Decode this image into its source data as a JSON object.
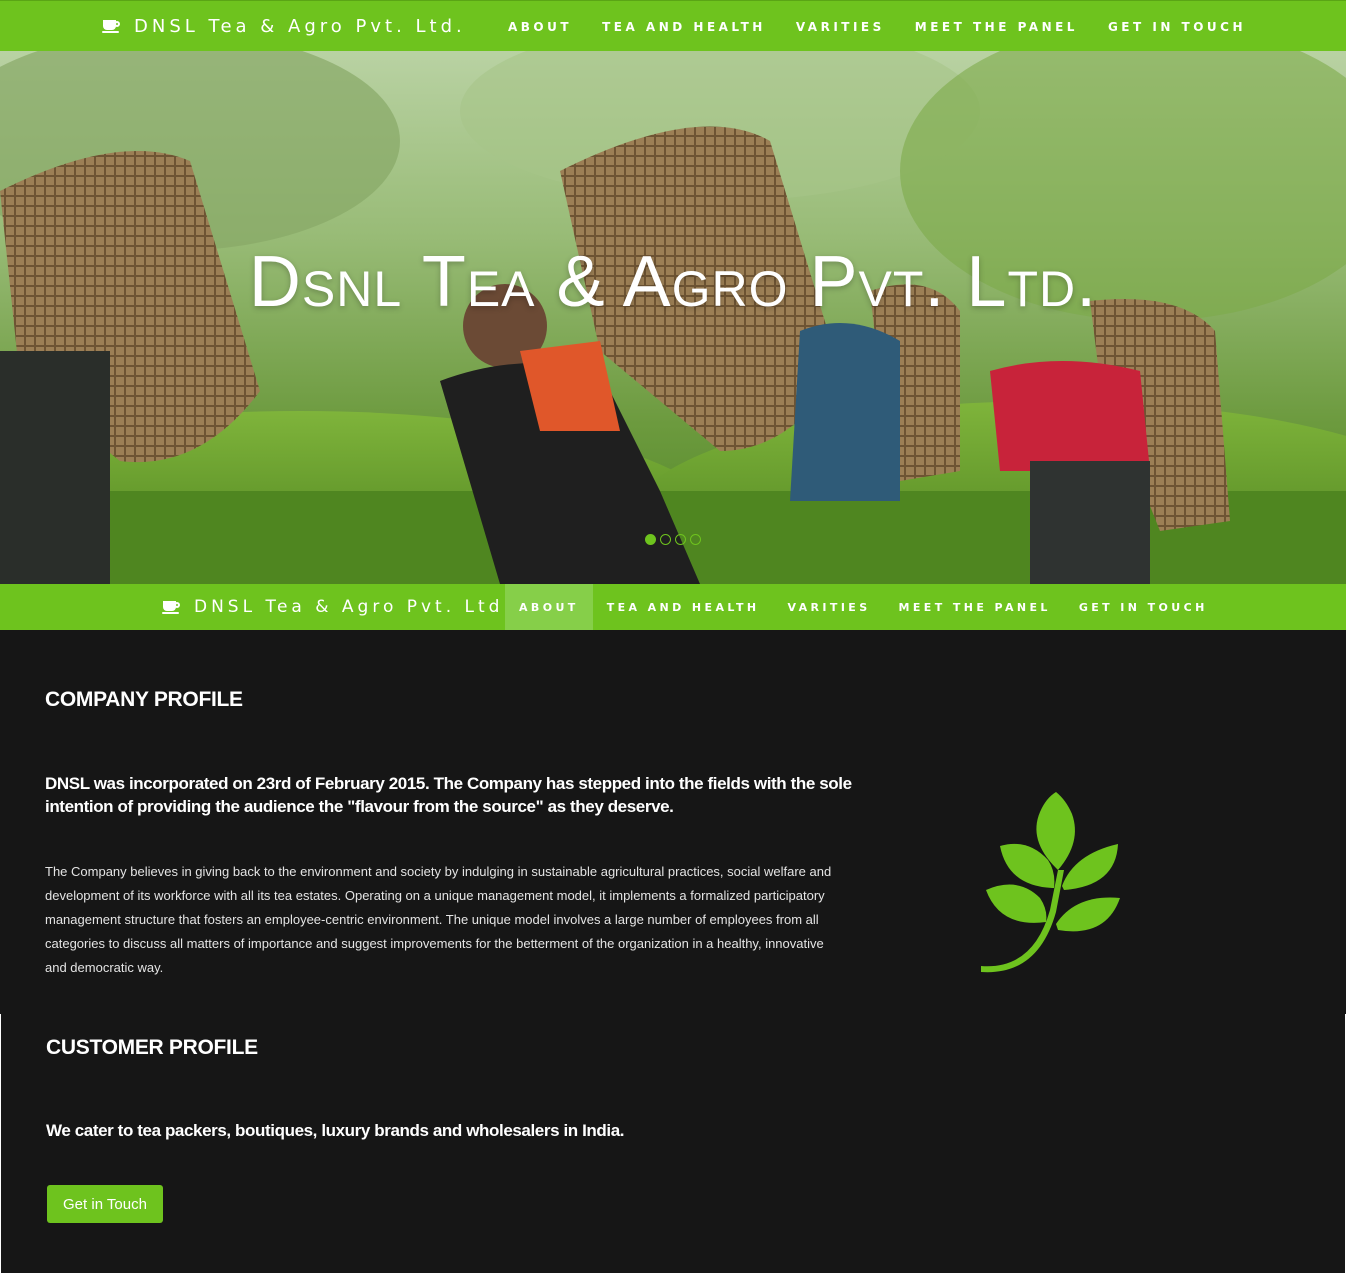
{
  "brand": {
    "name": "DNSL Tea & Agro Pvt. Ltd.",
    "icon": "tea-cup-icon"
  },
  "nav": {
    "items": [
      {
        "label": "ABOUT"
      },
      {
        "label": "TEA AND HEALTH"
      },
      {
        "label": "VARITIES"
      },
      {
        "label": "MEET THE PANEL"
      },
      {
        "label": "GET IN TOUCH"
      }
    ],
    "active_sticky": "ABOUT"
  },
  "hero": {
    "title": "Dsnl Tea & Agro Pvt. Ltd.",
    "slides_total": 4,
    "active_slide": 1
  },
  "company_profile": {
    "heading": "COMPANY PROFILE",
    "lead_line1": "DNSL was incorporated on 23rd of February 2015. The Company has stepped into the fields with the sole",
    "lead_line2": "intention of providing the audience the \"flavour from the source\" as they deserve.",
    "body_line1": "The Company believes in giving back to the environment and society by indulging in sustainable agricultural practices, social welfare and",
    "body_line2": "development of its workforce with all its tea estates. Operating on a unique management model, it implements a formalized participatory",
    "body_line3": "management structure that fosters an employee-centric environment. The unique model involves a large number of employees from all",
    "body_line4": "categories to discuss all matters of importance and suggest improvements for the betterment of the organization in a healthy, innovative",
    "body_line5": "and democratic way.",
    "illustration": "tea-leaf-icon"
  },
  "customer_profile": {
    "heading": "CUSTOMER PROFILE",
    "lead": "We cater to tea packers, boutiques, luxury brands and wholesalers in India.",
    "button_label": "Get in Touch"
  },
  "colors": {
    "brand_green": "#6ec31e",
    "active_tab": "#86cf49",
    "dark_bg": "#161616",
    "text": "#ffffff"
  }
}
